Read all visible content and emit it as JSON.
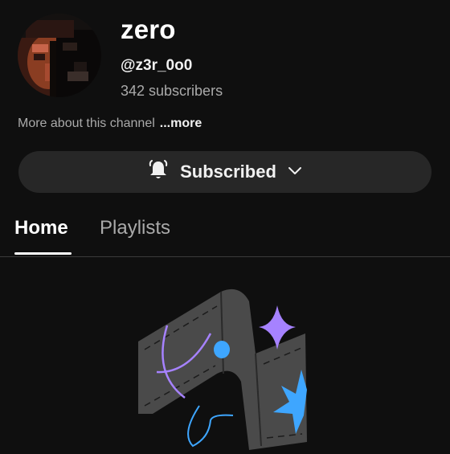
{
  "channel": {
    "name": "zero",
    "handle": "@z3r_0o0",
    "subscribers": "342 subscribers",
    "about_text": "More about this channel",
    "about_more": "...more"
  },
  "subscribe_button": {
    "label": "Subscribed",
    "icon": "bell-icon",
    "dropdown_icon": "chevron-down-icon"
  },
  "tabs": [
    {
      "label": "Home",
      "active": true
    },
    {
      "label": "Playlists",
      "active": false
    }
  ],
  "colors": {
    "background": "#0f0f0f",
    "button_bg": "#272727",
    "accent_purple": "#a682ff",
    "accent_blue": "#3ea6ff",
    "muted_text": "#aaaaaa"
  }
}
